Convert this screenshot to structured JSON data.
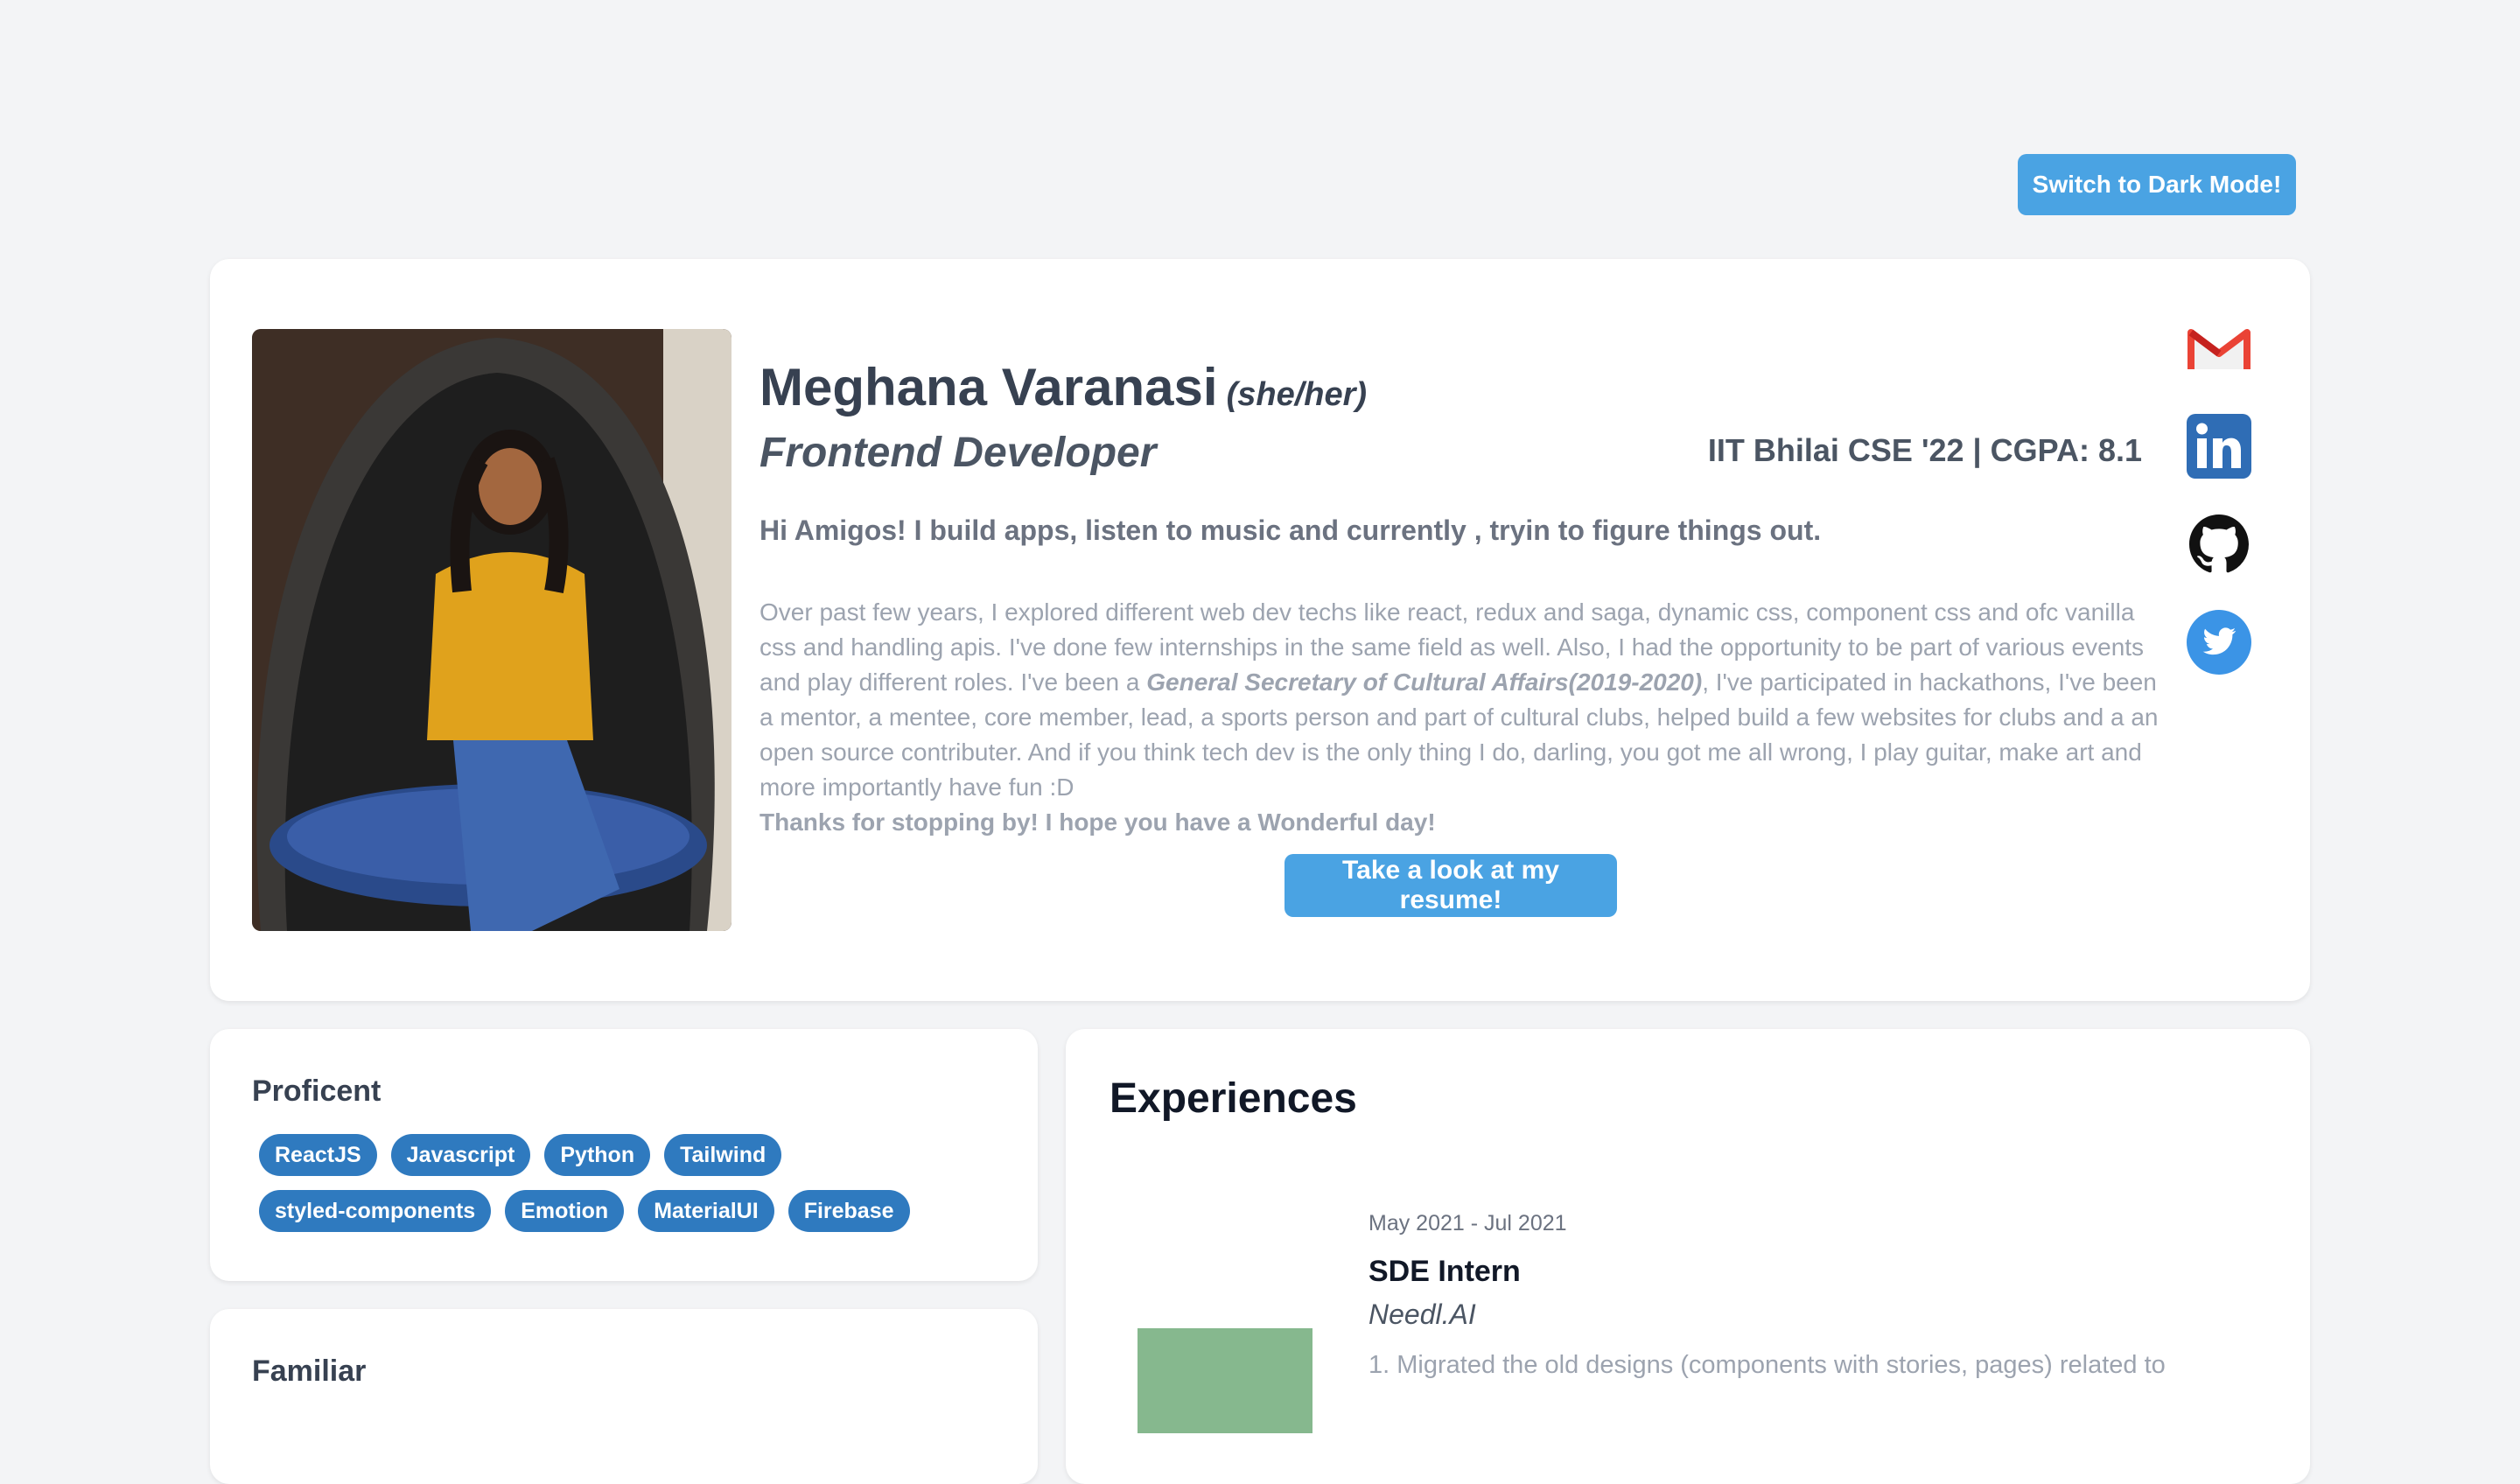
{
  "header": {
    "dark_mode_label": "Switch to Dark Mode!"
  },
  "profile": {
    "name": "Meghana Varanasi",
    "pronouns": "(she/her)",
    "role": "Frontend Developer",
    "education": "IIT Bhilai CSE '22 | CGPA: 8.1",
    "tagline": "Hi Amigos! I build apps, listen to music and currently , tryin to figure things out.",
    "bio_part1": "Over past few years, I explored different web dev techs like react, redux and saga, dynamic css, component css and ofc vanilla css and handling apis. I've done few internships in the same field as well. Also, I had the opportunity to be part of various events and play different roles. I've been a ",
    "bio_highlight": "General Secretary of Cultural Affairs(2019-2020)",
    "bio_part2": ", I've participated in hackathons, I've been a mentor, a mentee, core member, lead, a sports person and part of cultural clubs, helped build a few websites for clubs and a an open source contributer. And if you think tech dev is the only thing I do, darling, you got me all wrong, I play guitar, make art and more importantly have fun :D",
    "thanks": "Thanks for stopping by! I hope you have a Wonderful day!",
    "resume_label": "Take a look at my resume!"
  },
  "social": [
    {
      "icon": "gmail-icon"
    },
    {
      "icon": "linkedin-icon"
    },
    {
      "icon": "github-icon"
    },
    {
      "icon": "twitter-icon"
    }
  ],
  "skills": {
    "proficient_title": "Proficent",
    "proficient": [
      "ReactJS",
      "Javascript",
      "Python",
      "Tailwind",
      "styled-components",
      "Emotion",
      "MaterialUI",
      "Firebase"
    ],
    "familiar_title": "Familiar"
  },
  "experiences": {
    "title": "Experiences",
    "items": [
      {
        "date": "May 2021 - Jul 2021",
        "role": "SDE Intern",
        "company": "Needl.AI",
        "desc": "1. Migrated the old designs (components with stories, pages) related to"
      }
    ]
  },
  "colors": {
    "accent": "#4aa3e3",
    "tag": "#2f7abf",
    "background": "#f3f4f6"
  }
}
